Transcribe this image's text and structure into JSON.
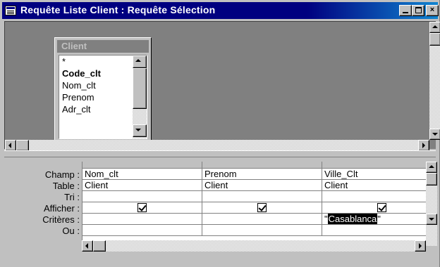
{
  "window": {
    "title": "Requête Liste Client : Requête Sélection",
    "buttons": {
      "minimize": "minimize",
      "maximize": "maximize",
      "close": "×"
    }
  },
  "field_list": {
    "table_name": "Client",
    "fields": [
      "*",
      "Code_clt",
      "Nom_clt",
      "Prenom",
      "Adr_clt"
    ],
    "primary_key": "Code_clt"
  },
  "grid": {
    "row_labels": [
      "Champ :",
      "Table :",
      "Tri :",
      "Afficher :",
      "Critères :",
      "Ou :"
    ],
    "columns": [
      {
        "champ": "Nom_clt",
        "table": "Client",
        "tri": "",
        "afficher": true,
        "criteres": "",
        "ou": ""
      },
      {
        "champ": "Prenom",
        "table": "Client",
        "tri": "",
        "afficher": true,
        "criteres": "",
        "ou": ""
      },
      {
        "champ": "Ville_Clt",
        "table": "Client",
        "tri": "",
        "afficher": true,
        "criteres": "\"Casablanca\"",
        "ou": ""
      }
    ],
    "criteria_quote_open": "\"",
    "criteria_selected": "Casablanca",
    "criteria_quote_close": "\""
  },
  "colors": {
    "titlebar": "#000080",
    "face": "#c0c0c0",
    "workspace": "#808080"
  }
}
